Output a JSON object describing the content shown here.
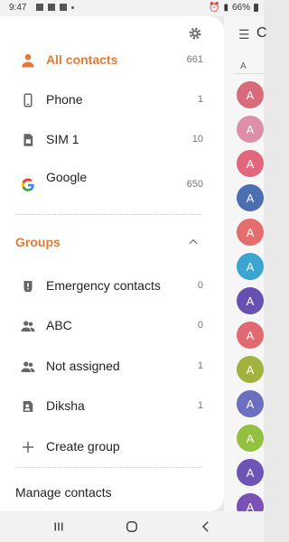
{
  "status_bar": {
    "time": "9:47",
    "battery": "66%"
  },
  "drawer": {
    "accounts": [
      {
        "name": "All contacts",
        "count": "661",
        "icon": "person-icon"
      },
      {
        "name": "Phone",
        "count": "1",
        "icon": "phone-icon"
      },
      {
        "name": "SIM 1",
        "count": "10",
        "icon": "sim-card-icon"
      },
      {
        "name": "Google",
        "count": "650",
        "icon": "google-icon"
      }
    ],
    "groups_title": "Groups",
    "groups": [
      {
        "name": "Emergency contacts",
        "count": "0",
        "icon": "alert-group-icon"
      },
      {
        "name": "ABC",
        "count": "0",
        "icon": "group-icon"
      },
      {
        "name": "Not assigned",
        "count": "1",
        "icon": "group-icon"
      },
      {
        "name": "Diksha",
        "count": "1",
        "icon": "group-icon"
      }
    ],
    "create_group": "Create group",
    "manage_contacts": "Manage contacts"
  },
  "background_list": {
    "section_letter": "A",
    "avatar_letter": "A",
    "avatar_colors": [
      "#d86a7a",
      "#dd8fa9",
      "#e2677c",
      "#4b6fb1",
      "#e46e6e",
      "#3ba5cf",
      "#6651b0",
      "#e16a72",
      "#a2b23f",
      "#6c6ec0",
      "#93c13f",
      "#6c55b4",
      "#7a52b5"
    ]
  },
  "colors": {
    "accent": "#e07b39"
  }
}
